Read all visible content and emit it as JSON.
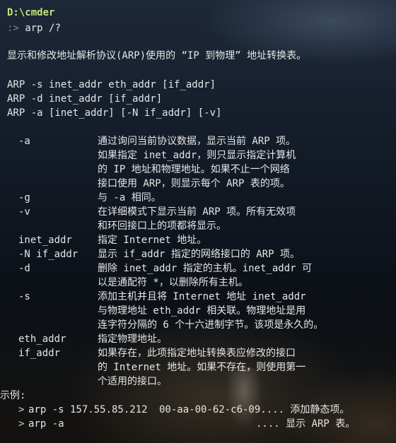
{
  "prompt_path": "D:\\cmder",
  "prompt_symbol": ":>",
  "command": "arp /?",
  "description": "显示和修改地址解析协议(ARP)使用的 “IP 到物理” 地址转换表。",
  "usage": [
    "ARP -s inet_addr eth_addr [if_addr]",
    "ARP -d inet_addr [if_addr]",
    "ARP -a [inet_addr] [-N if_addr] [-v]"
  ],
  "options": [
    {
      "flag": "-a",
      "lines": [
        "通过询问当前协议数据，显示当前 ARP 项。",
        "如果指定 inet_addr，则只显示指定计算机",
        "的 IP 地址和物理地址。如果不止一个网络",
        "接口使用 ARP，则显示每个 ARP 表的项。"
      ]
    },
    {
      "flag": "-g",
      "lines": [
        "与 -a 相同。"
      ]
    },
    {
      "flag": "-v",
      "lines": [
        "在详细模式下显示当前 ARP 项。所有无效项",
        "和环回接口上的项都将显示。"
      ]
    },
    {
      "flag": "inet_addr",
      "lines": [
        "指定 Internet 地址。"
      ]
    },
    {
      "flag": "-N if_addr",
      "lines": [
        "显示 if_addr 指定的网络接口的 ARP 项。"
      ]
    },
    {
      "flag": "-d",
      "lines": [
        "删除 inet_addr 指定的主机。inet_addr 可",
        "以是通配符 *，以删除所有主机。"
      ]
    },
    {
      "flag": "-s",
      "lines": [
        "添加主机并且将 Internet 地址 inet_addr",
        "与物理地址 eth_addr 相关联。物理地址是用",
        "连字符分隔的 6 个十六进制字节。该项是永久的。"
      ]
    },
    {
      "flag": "eth_addr",
      "lines": [
        "指定物理地址。"
      ]
    },
    {
      "flag": "if_addr",
      "lines": [
        "如果存在，此项指定地址转换表应修改的接口",
        "的 Internet 地址。如果不存在，则使用第一",
        "个适用的接口。"
      ]
    }
  ],
  "examples_label": "示例:",
  "examples": [
    {
      "arrow": ">",
      "command": "arp -s 157.55.85.212",
      "detail": "00-aa-00-62-c6-09.... 添加静态项。"
    },
    {
      "arrow": ">",
      "command": "arp -a",
      "detail": ".... 显示 ARP 表。"
    }
  ],
  "colors": {
    "path": "#c5e37a",
    "prompt": "#7a8794",
    "text": "#e6e6e6"
  }
}
